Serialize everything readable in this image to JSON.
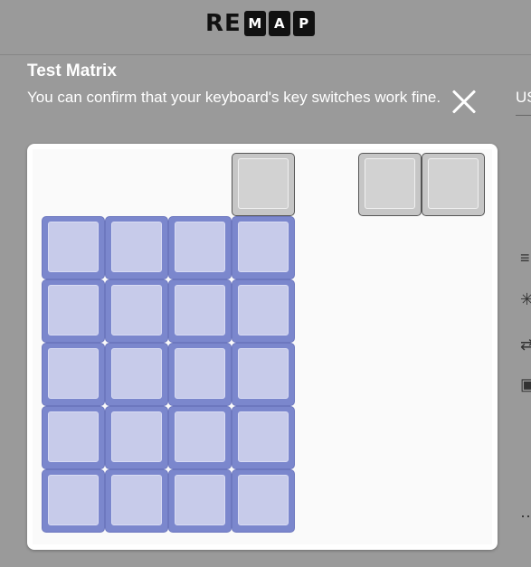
{
  "header": {
    "logo_plain": "RE",
    "logo_boxes": [
      "M",
      "A",
      "P"
    ]
  },
  "dialog": {
    "title": "Test Matrix",
    "description": "You can confirm that your keyboard's key switches work fine.",
    "close_icon": "close-icon"
  },
  "background_panel": {
    "label": "US"
  },
  "matrix": {
    "top_keys": [
      {
        "id": "top-key-1",
        "state": "inactive"
      },
      {
        "id": "top-key-2",
        "state": "inactive"
      },
      {
        "id": "top-key-3",
        "state": "inactive"
      }
    ],
    "rows": 5,
    "columns": 4,
    "grid_state": "active"
  },
  "colors": {
    "overlay_background": "#9a9a9a",
    "active_key": "#7b87cd",
    "active_cap": "#c7cbea",
    "inactive_key": "#c6c6c6"
  }
}
